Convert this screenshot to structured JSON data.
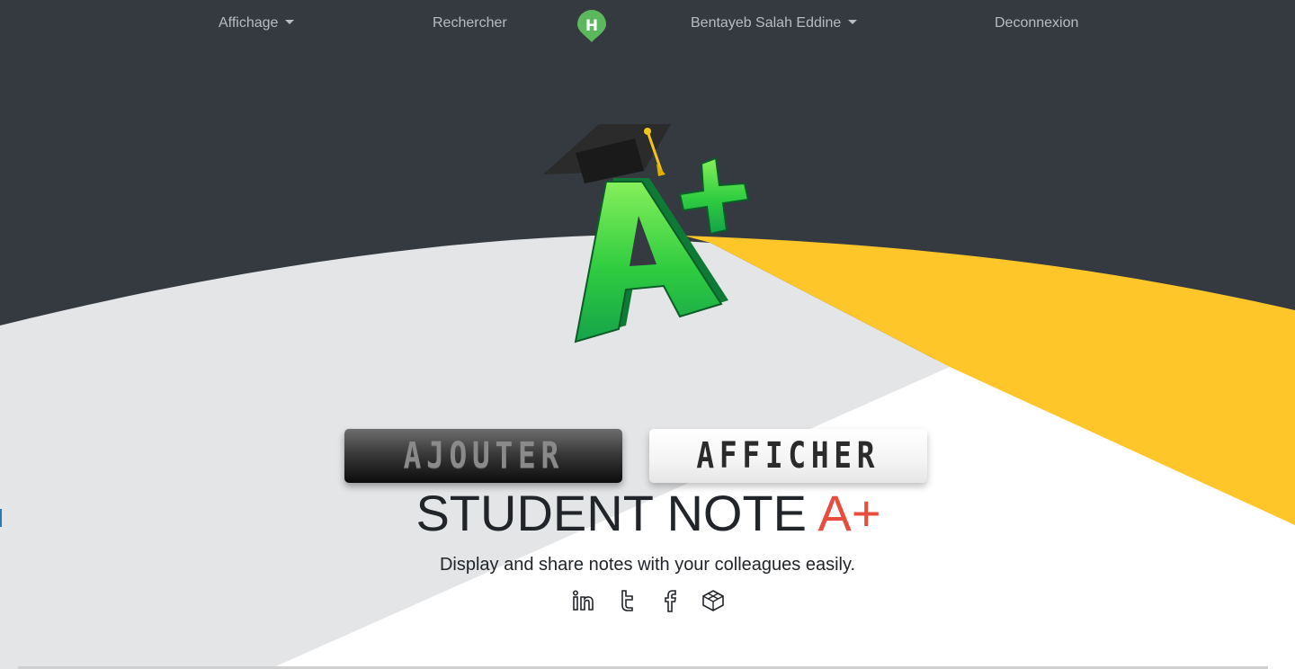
{
  "nav": {
    "affichage_label": "Affichage",
    "rechercher_label": "Rechercher",
    "brand_letter": "H",
    "user_label": "Bentayeb Salah Eddine",
    "logout_label": "Deconnexion"
  },
  "hero": {
    "logo_text": "A+",
    "button_add_label": "AJOUTER",
    "button_show_label": "AFFICHER",
    "title_main": "STUDENT NOTE ",
    "title_accent": "A+",
    "subtitle": "Display and share notes with your colleagues easily."
  },
  "socials": [
    {
      "icon": "linkedin-icon"
    },
    {
      "icon": "twitter-icon"
    },
    {
      "icon": "facebook-icon"
    },
    {
      "icon": "codepen-icon"
    }
  ],
  "colors": {
    "nav_bg": "#343a40",
    "grey_band": "#e4e5e7",
    "yellow_band": "#ffc629",
    "accent_red": "#e74c3c",
    "logo_green": "#2ecc40"
  }
}
